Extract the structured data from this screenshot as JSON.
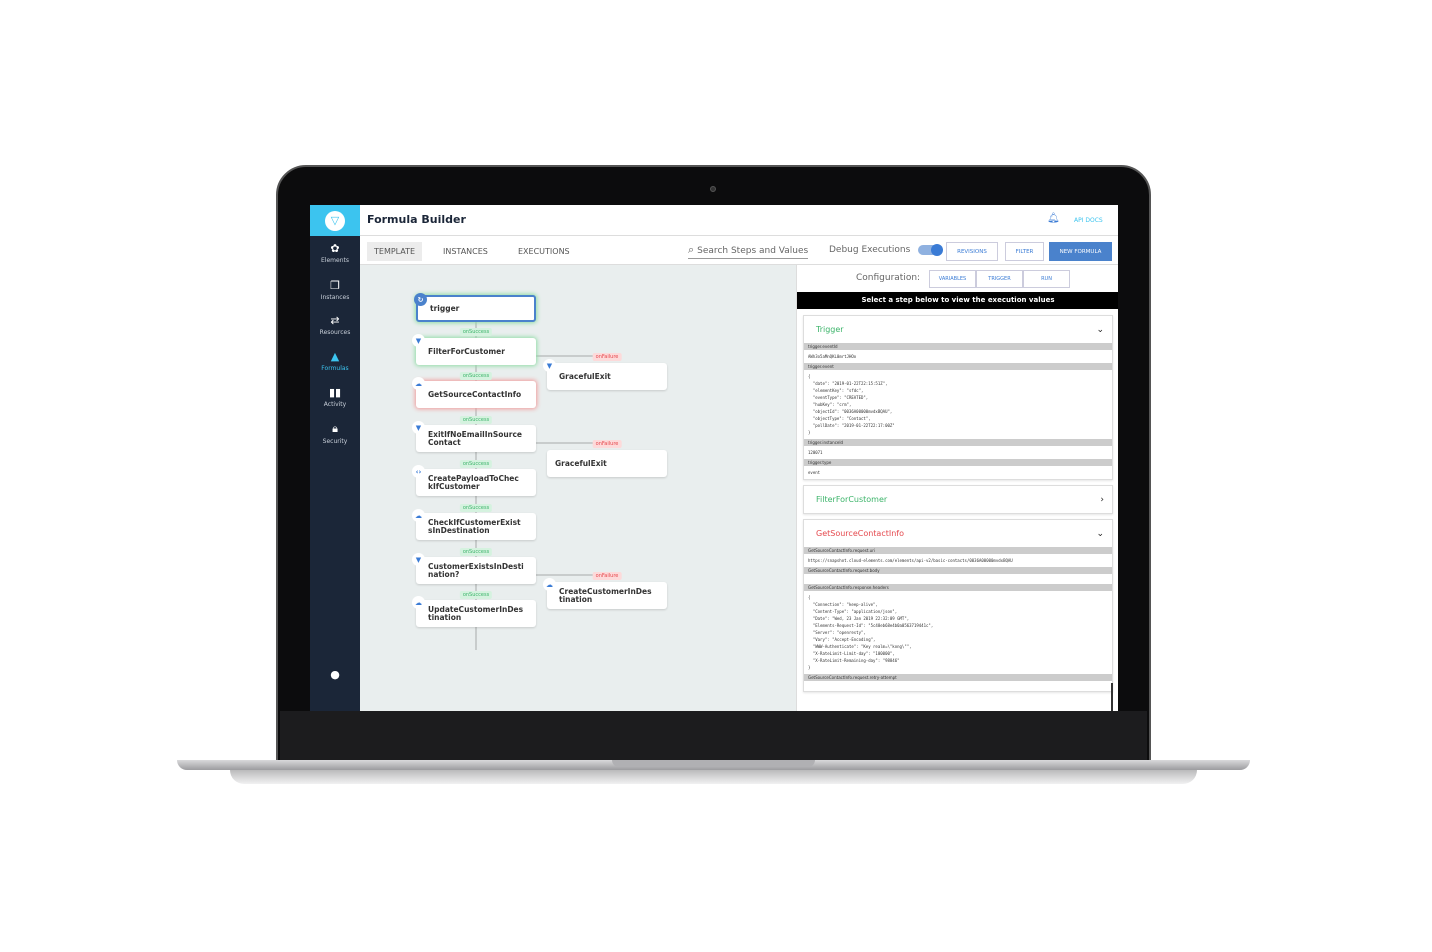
{
  "app": {
    "title": "Formula Builder",
    "api_docs": "API DOCS",
    "notification_icon": "bell-icon",
    "brand_color": "#3cc4ef",
    "accent_color": "#3a7bd5"
  },
  "sidebar": {
    "items": [
      {
        "label": "Elements",
        "icon": "elements-icon"
      },
      {
        "label": "Instances",
        "icon": "instances-icon"
      },
      {
        "label": "Resources",
        "icon": "resources-icon"
      },
      {
        "label": "Formulas",
        "icon": "formulas-icon",
        "active": true
      },
      {
        "label": "Activity",
        "icon": "activity-icon"
      },
      {
        "label": "Security",
        "icon": "lock-icon"
      }
    ],
    "user_icon": "user-icon"
  },
  "tabs": [
    {
      "label": "TEMPLATE",
      "active": true
    },
    {
      "label": "INSTANCES"
    },
    {
      "label": "EXECUTIONS"
    }
  ],
  "toolbar": {
    "search_placeholder": "Search Steps and Values",
    "debug_label": "Debug Executions",
    "debug_on": true,
    "revisions": "REVISIONS",
    "filter": "FILTER",
    "new_formula": "NEW FORMULA"
  },
  "canvas": {
    "steps": [
      {
        "name": "trigger",
        "icon": "trigger-icon"
      },
      {
        "name": "FilterForCustomer",
        "icon": "filter-icon"
      },
      {
        "name": "GetSourceContactInfo",
        "icon": "cloud-icon"
      },
      {
        "name": "ExitIfNoEmailInSource Contact",
        "icon": "filter-icon"
      },
      {
        "name": "CreatePayloadToChec kIfCustomer",
        "icon": "code-icon"
      },
      {
        "name": "CheckIfCustomerExist sInDestination",
        "icon": "cloud-icon"
      },
      {
        "name": "CustomerExistsInDesti nation?",
        "icon": "filter-icon"
      },
      {
        "name": "UpdateCustomerInDes tination",
        "icon": "cloud-icon"
      }
    ],
    "branches": [
      {
        "name": "GracefulExit",
        "icon": "filter-icon"
      },
      {
        "name": "GracefulExit",
        "icon": "none"
      },
      {
        "name": "CreateCustomerInDes tination",
        "icon": "cloud-icon"
      }
    ],
    "on_success": "onSuccess",
    "on_failure": "onFailure"
  },
  "panel": {
    "config_label": "Configuration:",
    "config_buttons": [
      "VARIABLES",
      "TRIGGER",
      "RUN"
    ],
    "banner": "Select a step below to view the execution values",
    "cards": [
      {
        "title": "Trigger",
        "color": "#3cb46a",
        "expanded": true,
        "fields": [
          {
            "key": "trigger.eventId",
            "value": "AWh3o5aMnQKL0mrtJHOo"
          },
          {
            "key": "trigger.event",
            "value": "{\n  \"date\": \"2019-01-22T22:15:51Z\",\n  \"elementKey\": \"sfdc\",\n  \"eventType\": \"CREATED\",\n  \"hubKey\": \"crm\",\n  \"objectId\": \"0036A00000mvdxBQAU\",\n  \"objectType\": \"Contact\",\n  \"pollDate\": \"2019-01-22T22:17:00Z\"\n}"
          },
          {
            "key": "trigger.instanceId",
            "value": "120071"
          },
          {
            "key": "trigger.type",
            "value": "event"
          }
        ]
      },
      {
        "title": "FilterForCustomer",
        "color": "#3cb46a",
        "expanded": false,
        "fields": []
      },
      {
        "title": "GetSourceContactInfo",
        "color": "#e5484d",
        "expanded": true,
        "fields": [
          {
            "key": "GetSourceContactInfo.request.uri",
            "value": "https://snapshot.cloud-elements.com/elements/api-v2/basic-contacts/0036A00000mvdxBQAU"
          },
          {
            "key": "GetSourceContactInfo.request.body",
            "value": ""
          },
          {
            "key": "GetSourceContactInfo.response.headers",
            "value": "{\n  \"Connection\": \"keep-alive\",\n  \"Content-Type\": \"application/json\",\n  \"Date\": \"Wed, 23 Jan 2019 22:32:09 GMT\",\n  \"Elements-Request-Id\": \"5c48eb68e4b0a0563719441c\",\n  \"Server\": \"openresty\",\n  \"Vary\": \"Accept-Encoding\",\n  \"WWW-Authenticate\": \"Key realm=\\\"kong\\\"\",\n  \"X-RateLimit-Limit-day\": \"100000\",\n  \"X-RateLimit-Remaining-day\": \"98846\"\n}"
          },
          {
            "key": "GetSourceContactInfo.request.retry-attempt",
            "value": ""
          }
        ]
      }
    ]
  }
}
